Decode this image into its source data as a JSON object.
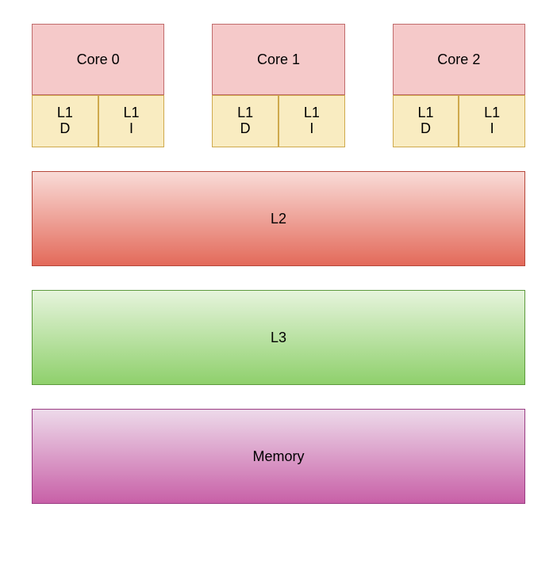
{
  "cores": [
    {
      "label": "Core 0",
      "l1d_line1": "L1",
      "l1d_line2": "D",
      "l1i_line1": "L1",
      "l1i_line2": "I"
    },
    {
      "label": "Core 1",
      "l1d_line1": "L1",
      "l1d_line2": "D",
      "l1i_line1": "L1",
      "l1i_line2": "I"
    },
    {
      "label": "Core 2",
      "l1d_line1": "L1",
      "l1d_line2": "D",
      "l1i_line1": "L1",
      "l1i_line2": "I"
    }
  ],
  "l2_label": "L2",
  "l3_label": "L3",
  "memory_label": "Memory"
}
